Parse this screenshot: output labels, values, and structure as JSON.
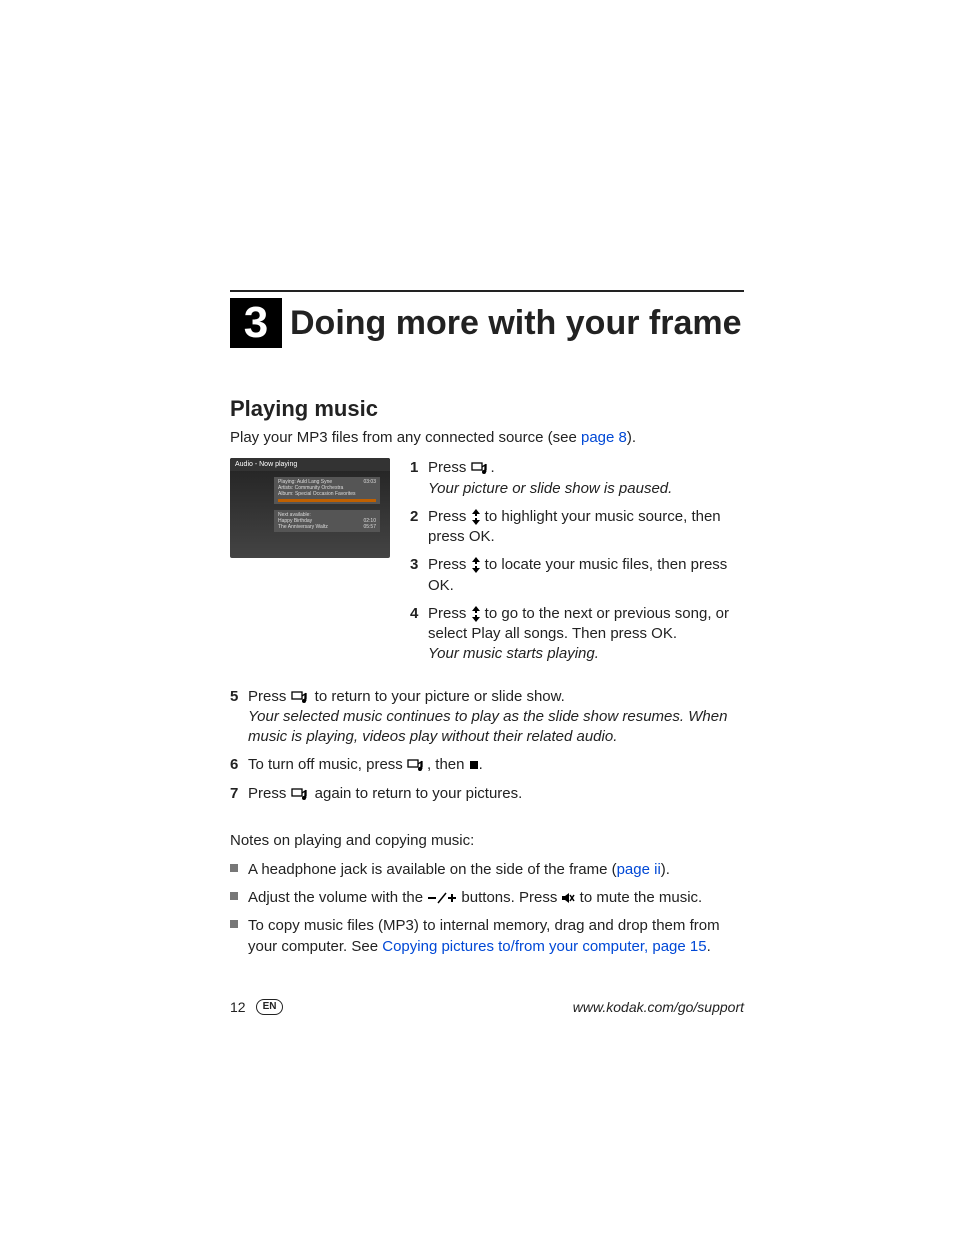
{
  "chapter": {
    "number": "3",
    "title": "Doing more with your frame"
  },
  "section": {
    "title": "Playing music"
  },
  "intro": {
    "before": "Play your MP3 files from any connected source (see ",
    "link": "page 8",
    "after": ")."
  },
  "screenshot": {
    "title": "Audio - Now playing",
    "playing": "Playing: Auld Lang Syne",
    "artist": "Artists: Community Orchestra",
    "album": "Album: Special Occasion Favorites",
    "time1": "03:03",
    "next": "Next available:",
    "song2": "Happy Birthday",
    "time2": "02:10",
    "song3": "The Anniversary Waltz",
    "time3": "05:57"
  },
  "steps_right": [
    {
      "n": "1",
      "a": "Press ",
      "b": ".",
      "result": "Your picture or slide show is paused."
    },
    {
      "n": "2",
      "a": "Press ",
      "b": " to highlight your music source, then press OK."
    },
    {
      "n": "3",
      "a": "Press ",
      "b": " to locate your music files, then press OK."
    },
    {
      "n": "4",
      "a": "Press ",
      "b": " to go to the next or previous song, or select Play all songs. Then press OK.",
      "result": "Your music starts playing."
    }
  ],
  "steps_full": [
    {
      "n": "5",
      "a": "Press ",
      "b": " to return to your picture or slide show.",
      "result": "Your selected music continues to play as the slide show resumes. When music is playing, videos play without their related audio."
    },
    {
      "n": "6",
      "a": "To turn off music, press ",
      "b": ", then ",
      "c": "."
    },
    {
      "n": "7",
      "a": "Press ",
      "b": " again to return to your pictures."
    }
  ],
  "notes_heading": "Notes on playing and copying music:",
  "notes": {
    "a1": "A headphone jack is available on the side of the frame (",
    "a_link": "page ii",
    "a2": ").",
    "b1": "Adjust the volume with the ",
    "b2": " buttons. Press ",
    "b3": " to mute the music.",
    "c1": "To copy music files (MP3) to internal memory, drag and drop them from your computer. See ",
    "c_link": "Copying pictures to/from your computer, page 15",
    "c2": "."
  },
  "footer": {
    "page": "12",
    "lang": "EN",
    "url": "www.kodak.com/go/support"
  }
}
